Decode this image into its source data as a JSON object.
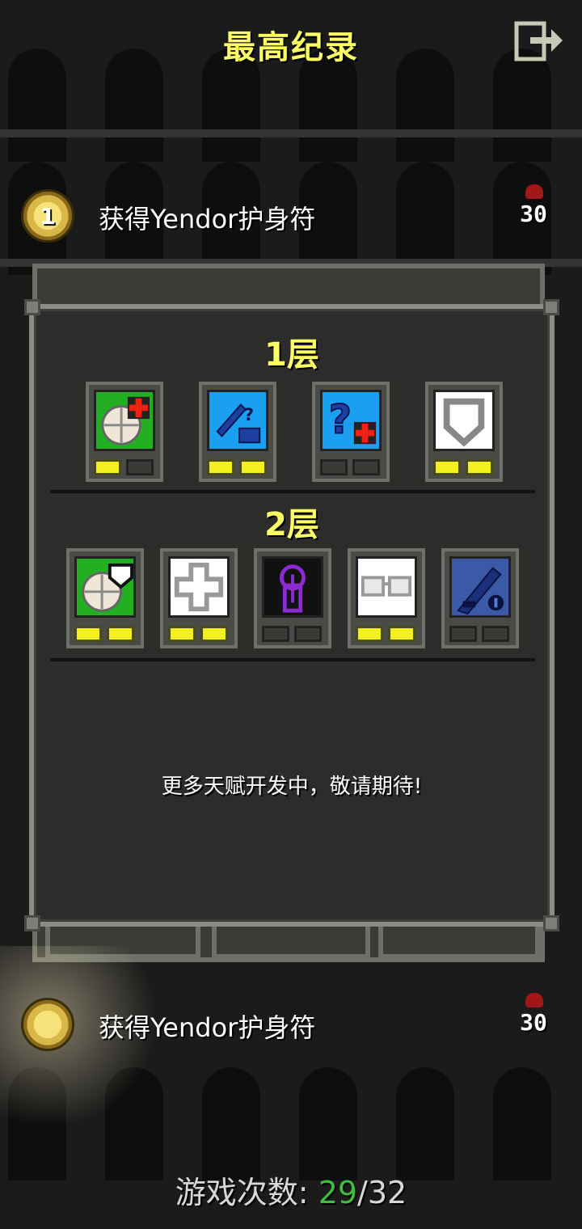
{
  "header": {
    "title": "最高纪录",
    "exit_icon": "exit-icon"
  },
  "records": [
    {
      "rank": "1",
      "text": "获得Yendor护身符",
      "depth": "30"
    },
    {
      "rank": "",
      "text": "获得Yendor护身符",
      "depth": "30"
    }
  ],
  "dialog": {
    "tiers": [
      {
        "title": "1层",
        "talents": [
          {
            "icon": "hearty-meal-icon",
            "bg": "#22b022",
            "pips": [
              true,
              false
            ]
          },
          {
            "icon": "unidentified-weapon-armor-icon",
            "bg": "#1aa0f0",
            "pips": [
              true,
              true
            ]
          },
          {
            "icon": "unidentified-heal-icon",
            "bg": "#1aa0f0",
            "pips": [
              false,
              false
            ]
          },
          {
            "icon": "armor-shield-icon",
            "bg": "#ffffff",
            "pips": [
              true,
              true
            ]
          }
        ]
      },
      {
        "title": "2层",
        "talents": [
          {
            "icon": "meal-shield-icon",
            "bg": "#22b022",
            "pips": [
              true,
              true
            ]
          },
          {
            "icon": "gray-cross-icon",
            "bg": "#ffffff",
            "pips": [
              true,
              true
            ]
          },
          {
            "icon": "purple-key-icon",
            "bg": "#111111",
            "pips": [
              false,
              false
            ]
          },
          {
            "icon": "glasses-icon",
            "bg": "#ffffff",
            "pips": [
              true,
              true
            ]
          },
          {
            "icon": "dagger-rune-icon",
            "bg": "#3a5aa8",
            "pips": [
              false,
              false
            ]
          }
        ]
      }
    ],
    "footer": "更多天赋开发中，敬请期待!"
  },
  "games": {
    "label": "游戏次数: ",
    "won": "29",
    "total": "/32"
  },
  "colors": {
    "accent_yellow": "#ffff66",
    "pip_on": "#f4f020",
    "won_green": "#3fbf3f"
  }
}
